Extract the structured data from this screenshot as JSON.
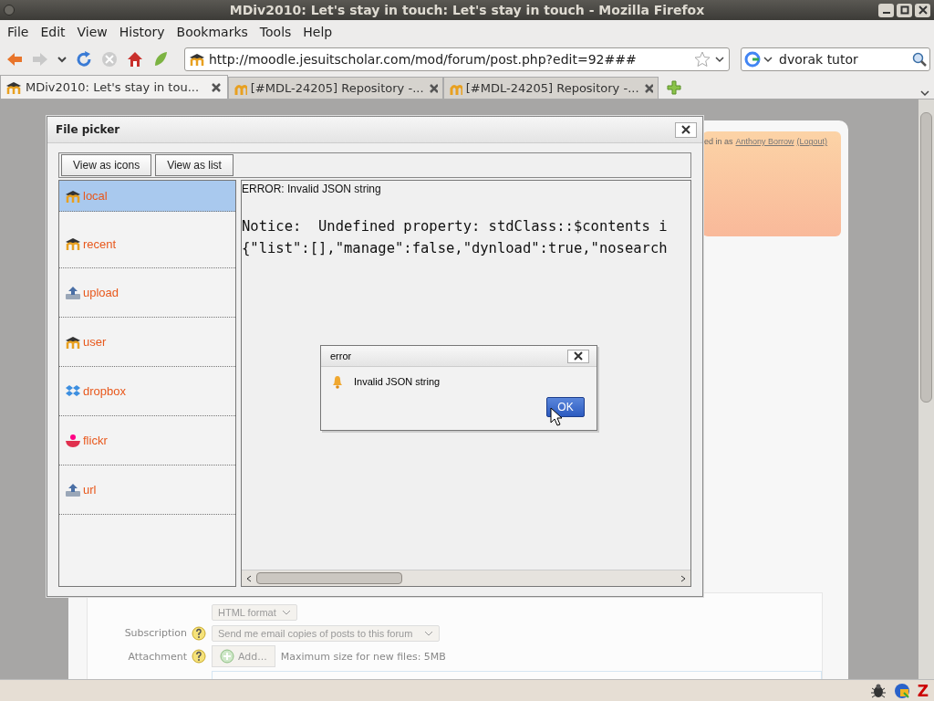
{
  "window": {
    "title": "MDiv2010: Let's stay in touch: Let's stay in touch - Mozilla Firefox"
  },
  "menu": [
    "File",
    "Edit",
    "View",
    "History",
    "Bookmarks",
    "Tools",
    "Help"
  ],
  "address_bar": {
    "value": "http://moodle.jesuitscholar.com/mod/forum/post.php?edit=92###"
  },
  "search_bar": {
    "value": "dvorak tutor"
  },
  "tabs": [
    {
      "label": "MDiv2010: Let's stay in tou...",
      "selected": true
    },
    {
      "label": "[#MDL-24205] Repository -...",
      "selected": false
    },
    {
      "label": "[#MDL-24205] Repository -...",
      "selected": false
    }
  ],
  "page": {
    "login_prefix": "ed in as",
    "user_link": "Anthony Borrow",
    "logout_link": "(Logout)",
    "format_select": "HTML format",
    "subscription_label": "Subscription",
    "subscription_select": "Send me email copies of posts to this forum",
    "attachment_label": "Attachment",
    "add_button": "Add...",
    "max_size_note": "Maximum size for new files: 5MB"
  },
  "file_picker": {
    "title": "File picker",
    "view_buttons": [
      "View as icons",
      "View as list"
    ],
    "repositories": [
      {
        "label": "local",
        "kind": "moodle",
        "selected": true
      },
      {
        "label": "recent",
        "kind": "moodle",
        "selected": false
      },
      {
        "label": "upload",
        "kind": "upload",
        "selected": false
      },
      {
        "label": "user",
        "kind": "moodle",
        "selected": false
      },
      {
        "label": "dropbox",
        "kind": "dropbox",
        "selected": false
      },
      {
        "label": "flickr",
        "kind": "flickr",
        "selected": false
      },
      {
        "label": "url",
        "kind": "upload",
        "selected": false
      }
    ],
    "error_line": "ERROR: Invalid JSON string",
    "output_lines": [
      "Notice:  Undefined property: stdClass::$contents i",
      "{\"list\":[],\"manage\":false,\"dynload\":true,\"nosearch"
    ]
  },
  "error_dialog": {
    "title": "error",
    "message": "Invalid JSON string",
    "ok_button": "OK"
  },
  "status_bar": {
    "addon_mark": "Z"
  }
}
